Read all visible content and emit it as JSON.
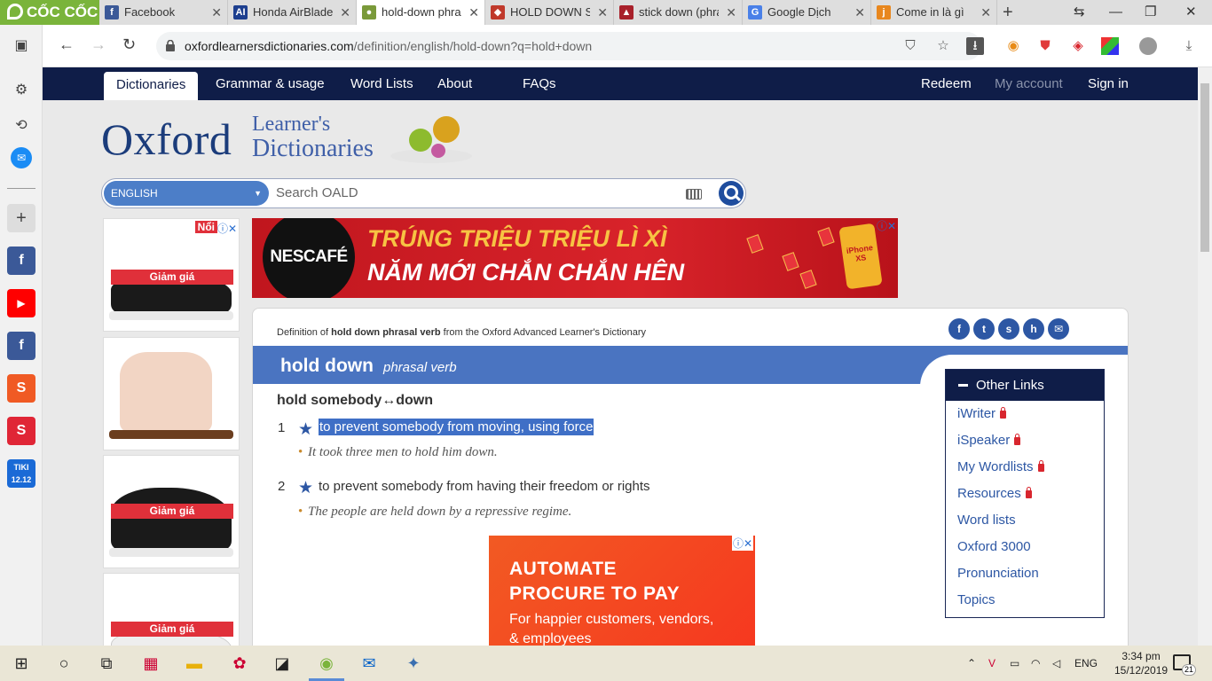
{
  "browser": {
    "brand": "CỐC CỐC",
    "tabs": [
      {
        "label": "Facebook",
        "fav": "f",
        "color": "#3b5998"
      },
      {
        "label": "Honda AirBlade",
        "fav": "AI",
        "color": "#1d3f8f"
      },
      {
        "label": "hold-down phras",
        "fav": "●",
        "color": "#7a9a3a"
      },
      {
        "label": "HOLD DOWN SC",
        "fav": "◆",
        "color": "#c0392b"
      },
      {
        "label": "stick down (phra",
        "fav": "▲",
        "color": "#a8202a"
      },
      {
        "label": "Google Dịch",
        "fav": "G",
        "color": "#4a80e8"
      },
      {
        "label": "Come in là gì",
        "fav": "j",
        "color": "#e8871e"
      }
    ],
    "url_host": "oxfordlearnersdictionaries.com",
    "url_path": "/definition/english/hold-down?q=hold+down"
  },
  "nav": {
    "items": [
      "Dictionaries",
      "Grammar & usage",
      "Word Lists",
      "About",
      "FAQs"
    ],
    "right": [
      "Redeem",
      "My account",
      "Sign in"
    ]
  },
  "logo": {
    "oxford": "Oxford",
    "learners": "Learner's",
    "dictionaries": "Dictionaries"
  },
  "search": {
    "language": "ENGLISH",
    "placeholder": "Search OALD"
  },
  "ads": {
    "sale_label": "Giảm giá",
    "badge": "Nổi",
    "banner_brand": "NESCAFÉ",
    "banner_line1": "TRÚNG TRIỆU TRIỆU LÌ XÌ",
    "banner_line2": "NĂM MỚI CHẮN CHẮN HÊN",
    "banner_phone": "iPhone XS",
    "mid_heading_1": "AUTOMATE",
    "mid_heading_2": "PROCURE TO PAY",
    "mid_sub_1": "For happier customers, vendors,",
    "mid_sub_2": "& employees"
  },
  "entry": {
    "source_prefix": "Definition of ",
    "source_bold": "hold down phrasal verb",
    "source_suffix": " from the Oxford Advanced Learner's Dictionary",
    "headword": "hold down",
    "pos": "phrasal verb",
    "phrasal": "hold somebody↔down",
    "senses": [
      {
        "num": "1",
        "def": "to prevent somebody from moving, using force",
        "example": "It took three men to hold him down."
      },
      {
        "num": "2",
        "def": "to prevent somebody from having their freedom or rights",
        "example": "The people are held down by a repressive regime."
      }
    ]
  },
  "other_links": {
    "title": "Other Links",
    "items": [
      {
        "label": "iWriter",
        "locked": true
      },
      {
        "label": "iSpeaker",
        "locked": true
      },
      {
        "label": "My Wordlists",
        "locked": true
      },
      {
        "label": "Resources",
        "locked": true
      },
      {
        "label": "Word lists",
        "locked": false
      },
      {
        "label": "Oxford 3000",
        "locked": false
      },
      {
        "label": "Pronunciation",
        "locked": false
      },
      {
        "label": "Topics",
        "locked": false
      }
    ]
  },
  "taskbar": {
    "lang": "ENG",
    "time": "3:34 pm",
    "date": "15/12/2019",
    "notifications": "21"
  }
}
